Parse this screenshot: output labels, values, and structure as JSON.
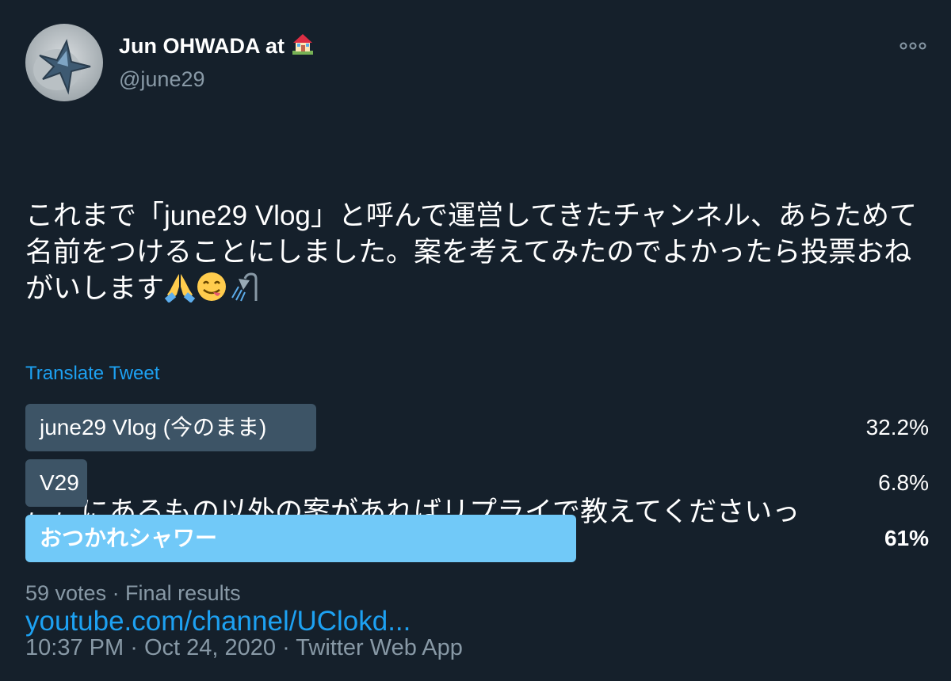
{
  "author": {
    "display_name": "Jun OHWADA at",
    "handle": "@june29",
    "badge_icon": "house-with-garden-icon"
  },
  "more_icon": "more-options-icon",
  "tweet": {
    "text_paragraph_1": "これまで「june29 Vlog」と呼んで運営してきたチャンネル、あらためて名前をつけることにしました。案を考えてみたのでよかったら投票おねがいします",
    "emojis": [
      "folded-hands-icon",
      "face-savoring-food-icon",
      "shower-icon"
    ],
    "text_paragraph_2": "ここにあるもの以外の案があればリプライで教えてくださいっ",
    "link": "youtube.com/channel/UClokd..."
  },
  "translate_label": "Translate Tweet",
  "poll": {
    "options": [
      {
        "label": "june29 Vlog (今のまま)",
        "percent_label": "32.2%",
        "percent": 32.2,
        "winner": false
      },
      {
        "label": "V29",
        "percent_label": "6.8%",
        "percent": 6.8,
        "winner": false
      },
      {
        "label": "おつかれシャワー",
        "percent_label": "61%",
        "percent": 61,
        "winner": true
      }
    ],
    "summary": "59 votes · Final results"
  },
  "timestamp": {
    "time": "10:37 PM",
    "date": "Oct 24, 2020",
    "source": "Twitter Web App",
    "separator": "·"
  },
  "colors": {
    "background": "#15202b",
    "accent": "#1da1f2",
    "muted": "#8899a6",
    "bar": "#3d5466",
    "bar_winner": "#71c9f8"
  }
}
